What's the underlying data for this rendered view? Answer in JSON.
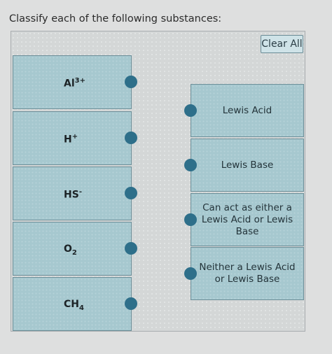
{
  "question": "Classify each of the following substances:",
  "clear_all": "Clear All",
  "items": [
    {
      "base": "Al",
      "sup": "3+",
      "sub": ""
    },
    {
      "base": "H",
      "sup": "+",
      "sub": ""
    },
    {
      "base": "HS",
      "sup": "-",
      "sub": ""
    },
    {
      "base": "O",
      "sup": "",
      "sub": "2"
    },
    {
      "base": "CH",
      "sup": "",
      "sub": "4"
    }
  ],
  "categories": [
    "Lewis Acid",
    "Lewis Base",
    "Can act as either a Lewis Acid or Lewis Base",
    "Neither a Lewis Acid or Lewis Base"
  ],
  "colors": {
    "card_fill": "#a6c8cf",
    "card_border": "#6d8f99",
    "connector": "#2e6f8a",
    "button_fill": "#cfe3e8"
  },
  "icons": {
    "connector": "semicircle-tab"
  }
}
